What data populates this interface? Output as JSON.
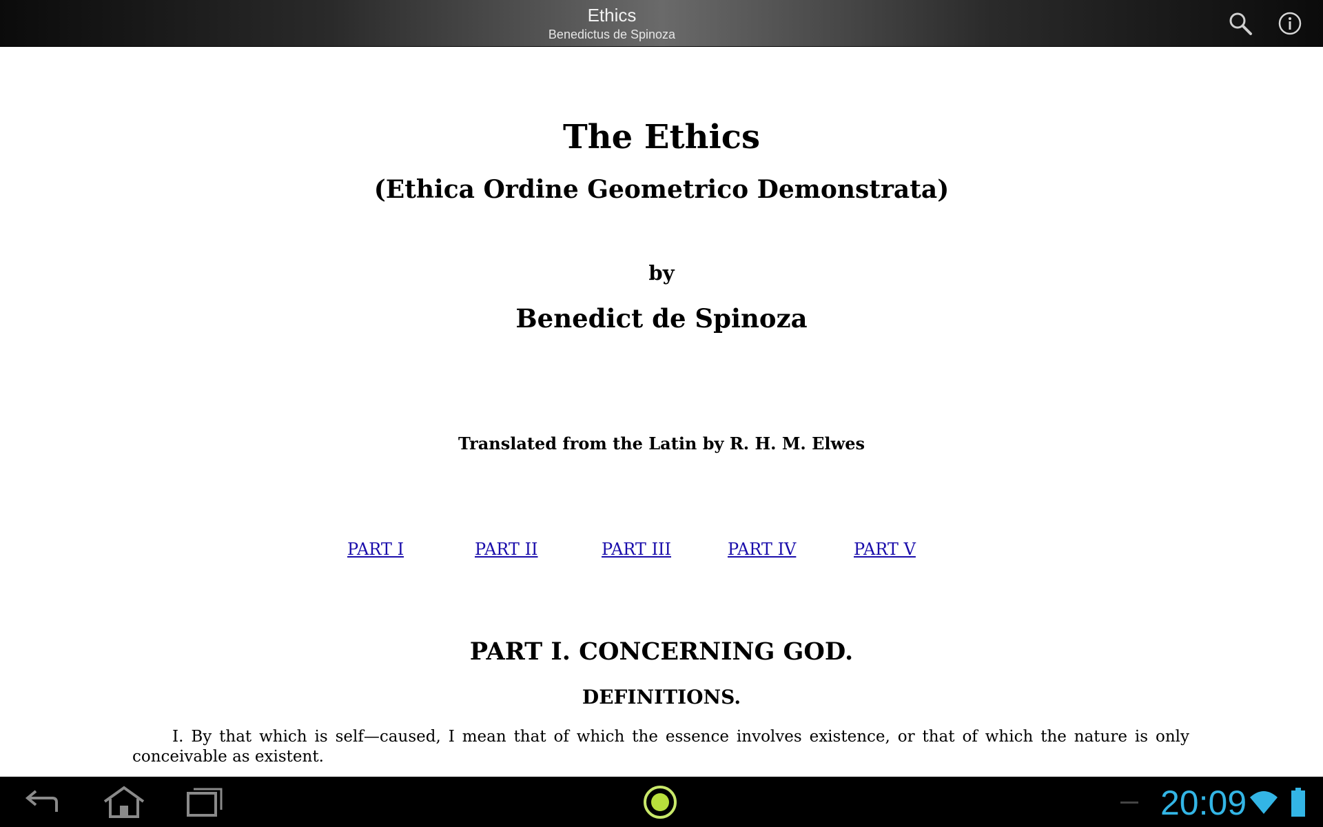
{
  "topbar": {
    "title": "Ethics",
    "subtitle": "Benedictus de Spinoza",
    "search_icon": "search-icon",
    "info_icon": "info-icon"
  },
  "book": {
    "title": "The Ethics",
    "subtitle": "(Ethica Ordine Geometrico Demonstrata)",
    "by": "by",
    "author": "Benedict de Spinoza",
    "translated": "Translated from the Latin by R. H. M. Elwes",
    "parts": [
      {
        "label": "PART I"
      },
      {
        "label": "PART II"
      },
      {
        "label": "PART III"
      },
      {
        "label": "PART IV"
      },
      {
        "label": "PART V"
      }
    ],
    "part_heading": "PART I. CONCERNING GOD.",
    "section_heading": "DEFINITIONS.",
    "paragraph": "I. By that which is self—caused, I mean that of which the essence involves existence, or that of which the nature is only conceivable as existent."
  },
  "navbar": {
    "clock": "20:09",
    "icons": [
      "back-icon",
      "home-icon",
      "recents-icon",
      "reader-icon",
      "wifi-icon",
      "battery-icon"
    ],
    "accent_color": "#33b5e5"
  }
}
